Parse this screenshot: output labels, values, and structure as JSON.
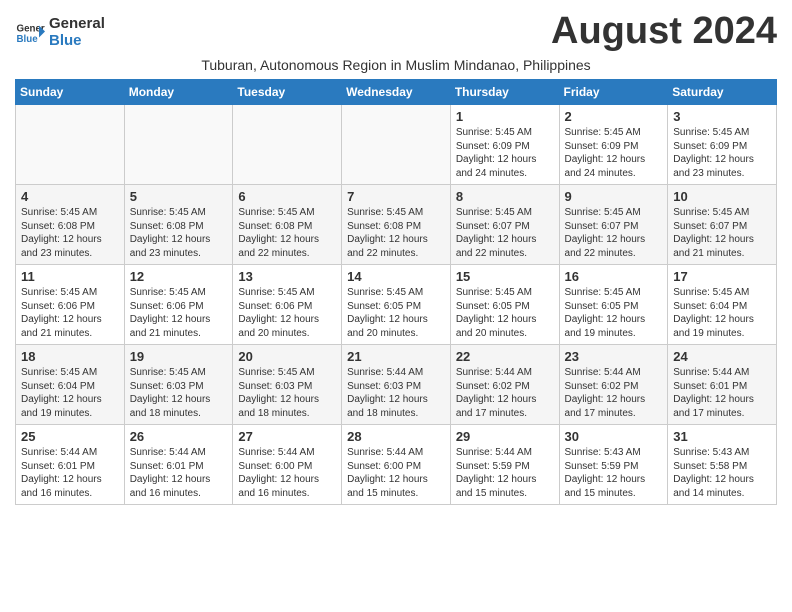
{
  "header": {
    "logo_general": "General",
    "logo_blue": "Blue",
    "month_title": "August 2024",
    "subtitle": "Tuburan, Autonomous Region in Muslim Mindanao, Philippines"
  },
  "weekdays": [
    "Sunday",
    "Monday",
    "Tuesday",
    "Wednesday",
    "Thursday",
    "Friday",
    "Saturday"
  ],
  "weeks": [
    [
      {
        "day": "",
        "info": ""
      },
      {
        "day": "",
        "info": ""
      },
      {
        "day": "",
        "info": ""
      },
      {
        "day": "",
        "info": ""
      },
      {
        "day": "1",
        "info": "Sunrise: 5:45 AM\nSunset: 6:09 PM\nDaylight: 12 hours\nand 24 minutes."
      },
      {
        "day": "2",
        "info": "Sunrise: 5:45 AM\nSunset: 6:09 PM\nDaylight: 12 hours\nand 24 minutes."
      },
      {
        "day": "3",
        "info": "Sunrise: 5:45 AM\nSunset: 6:09 PM\nDaylight: 12 hours\nand 23 minutes."
      }
    ],
    [
      {
        "day": "4",
        "info": "Sunrise: 5:45 AM\nSunset: 6:08 PM\nDaylight: 12 hours\nand 23 minutes."
      },
      {
        "day": "5",
        "info": "Sunrise: 5:45 AM\nSunset: 6:08 PM\nDaylight: 12 hours\nand 23 minutes."
      },
      {
        "day": "6",
        "info": "Sunrise: 5:45 AM\nSunset: 6:08 PM\nDaylight: 12 hours\nand 22 minutes."
      },
      {
        "day": "7",
        "info": "Sunrise: 5:45 AM\nSunset: 6:08 PM\nDaylight: 12 hours\nand 22 minutes."
      },
      {
        "day": "8",
        "info": "Sunrise: 5:45 AM\nSunset: 6:07 PM\nDaylight: 12 hours\nand 22 minutes."
      },
      {
        "day": "9",
        "info": "Sunrise: 5:45 AM\nSunset: 6:07 PM\nDaylight: 12 hours\nand 22 minutes."
      },
      {
        "day": "10",
        "info": "Sunrise: 5:45 AM\nSunset: 6:07 PM\nDaylight: 12 hours\nand 21 minutes."
      }
    ],
    [
      {
        "day": "11",
        "info": "Sunrise: 5:45 AM\nSunset: 6:06 PM\nDaylight: 12 hours\nand 21 minutes."
      },
      {
        "day": "12",
        "info": "Sunrise: 5:45 AM\nSunset: 6:06 PM\nDaylight: 12 hours\nand 21 minutes."
      },
      {
        "day": "13",
        "info": "Sunrise: 5:45 AM\nSunset: 6:06 PM\nDaylight: 12 hours\nand 20 minutes."
      },
      {
        "day": "14",
        "info": "Sunrise: 5:45 AM\nSunset: 6:05 PM\nDaylight: 12 hours\nand 20 minutes."
      },
      {
        "day": "15",
        "info": "Sunrise: 5:45 AM\nSunset: 6:05 PM\nDaylight: 12 hours\nand 20 minutes."
      },
      {
        "day": "16",
        "info": "Sunrise: 5:45 AM\nSunset: 6:05 PM\nDaylight: 12 hours\nand 19 minutes."
      },
      {
        "day": "17",
        "info": "Sunrise: 5:45 AM\nSunset: 6:04 PM\nDaylight: 12 hours\nand 19 minutes."
      }
    ],
    [
      {
        "day": "18",
        "info": "Sunrise: 5:45 AM\nSunset: 6:04 PM\nDaylight: 12 hours\nand 19 minutes."
      },
      {
        "day": "19",
        "info": "Sunrise: 5:45 AM\nSunset: 6:03 PM\nDaylight: 12 hours\nand 18 minutes."
      },
      {
        "day": "20",
        "info": "Sunrise: 5:45 AM\nSunset: 6:03 PM\nDaylight: 12 hours\nand 18 minutes."
      },
      {
        "day": "21",
        "info": "Sunrise: 5:44 AM\nSunset: 6:03 PM\nDaylight: 12 hours\nand 18 minutes."
      },
      {
        "day": "22",
        "info": "Sunrise: 5:44 AM\nSunset: 6:02 PM\nDaylight: 12 hours\nand 17 minutes."
      },
      {
        "day": "23",
        "info": "Sunrise: 5:44 AM\nSunset: 6:02 PM\nDaylight: 12 hours\nand 17 minutes."
      },
      {
        "day": "24",
        "info": "Sunrise: 5:44 AM\nSunset: 6:01 PM\nDaylight: 12 hours\nand 17 minutes."
      }
    ],
    [
      {
        "day": "25",
        "info": "Sunrise: 5:44 AM\nSunset: 6:01 PM\nDaylight: 12 hours\nand 16 minutes."
      },
      {
        "day": "26",
        "info": "Sunrise: 5:44 AM\nSunset: 6:01 PM\nDaylight: 12 hours\nand 16 minutes."
      },
      {
        "day": "27",
        "info": "Sunrise: 5:44 AM\nSunset: 6:00 PM\nDaylight: 12 hours\nand 16 minutes."
      },
      {
        "day": "28",
        "info": "Sunrise: 5:44 AM\nSunset: 6:00 PM\nDaylight: 12 hours\nand 15 minutes."
      },
      {
        "day": "29",
        "info": "Sunrise: 5:44 AM\nSunset: 5:59 PM\nDaylight: 12 hours\nand 15 minutes."
      },
      {
        "day": "30",
        "info": "Sunrise: 5:43 AM\nSunset: 5:59 PM\nDaylight: 12 hours\nand 15 minutes."
      },
      {
        "day": "31",
        "info": "Sunrise: 5:43 AM\nSunset: 5:58 PM\nDaylight: 12 hours\nand 14 minutes."
      }
    ]
  ]
}
